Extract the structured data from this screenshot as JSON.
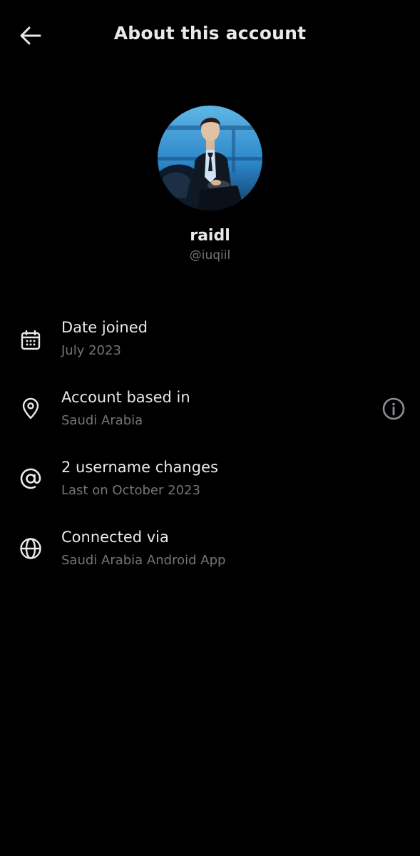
{
  "header": {
    "title": "About this account",
    "back_icon": "arrow-left-icon"
  },
  "profile": {
    "display_name": "raidl",
    "handle": "@iuqiil"
  },
  "rows": [
    {
      "icon": "calendar-icon",
      "label": "Date joined",
      "value": "July 2023"
    },
    {
      "icon": "location-pin-icon",
      "label": "Account based in",
      "value": "Saudi Arabia"
    },
    {
      "icon": "at-sign-icon",
      "label": "2 username changes",
      "value": "Last on October 2023"
    },
    {
      "icon": "globe-icon",
      "label": "Connected via",
      "value": "Saudi Arabia Android App"
    }
  ],
  "colors": {
    "background": "#000000",
    "primary_text": "#e7e9ea",
    "secondary_text": "#71767b"
  }
}
